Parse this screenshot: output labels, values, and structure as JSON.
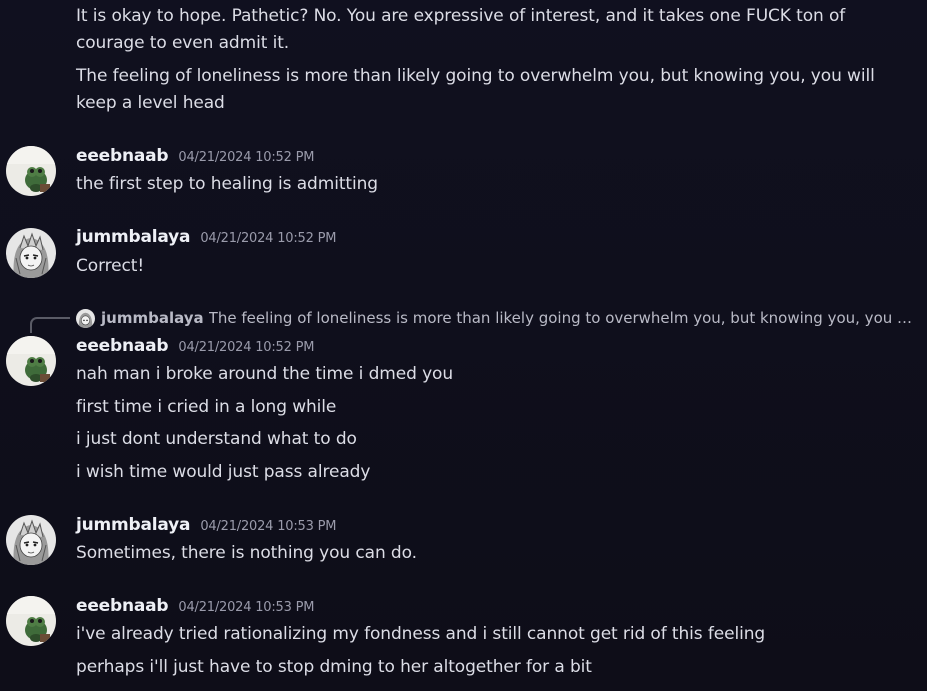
{
  "top_messages": {
    "line1": "It is okay to hope. Pathetic? No. You are expressive of interest, and it takes one FUCK ton of courage to even admit it.",
    "line2": "The feeling of loneliness is more than likely going to overwhelm you, but knowing you, you will keep a level head"
  },
  "messages": [
    {
      "username": "eeebnaab",
      "timestamp": "04/21/2024 10:52 PM",
      "avatar": "frog-plush-avatar",
      "lines": [
        "the first step to healing is admitting"
      ]
    },
    {
      "username": "jummbalaya",
      "timestamp": "04/21/2024 10:52 PM",
      "avatar": "manga-girl-avatar",
      "lines": [
        "Correct!"
      ]
    },
    {
      "reply": {
        "username": "jummbalaya",
        "text": "The feeling of loneliness is more than likely going to overwhelm you, but knowing you, you will keep a level head"
      },
      "username": "eeebnaab",
      "timestamp": "04/21/2024 10:52 PM",
      "avatar": "frog-plush-avatar",
      "lines": [
        "nah man i broke around the time i dmed you",
        "first time i cried in a long while",
        "i just dont understand what to do",
        "i wish time would just pass already"
      ]
    },
    {
      "username": "jummbalaya",
      "timestamp": "04/21/2024 10:53 PM",
      "avatar": "manga-girl-avatar",
      "lines": [
        "Sometimes, there is nothing you can do."
      ]
    },
    {
      "username": "eeebnaab",
      "timestamp": "04/21/2024 10:53 PM",
      "avatar": "frog-plush-avatar",
      "lines": [
        "i've already tried rationalizing my fondness and i still cannot get rid of this feeling",
        "perhaps i'll just have to stop dming to her altogether for a bit"
      ]
    }
  ],
  "colors": {
    "background": "#10101f",
    "text": "#dcdde6",
    "username": "#eef0f6",
    "timestamp": "#9a9bab",
    "reply_text": "#b9bac6"
  }
}
